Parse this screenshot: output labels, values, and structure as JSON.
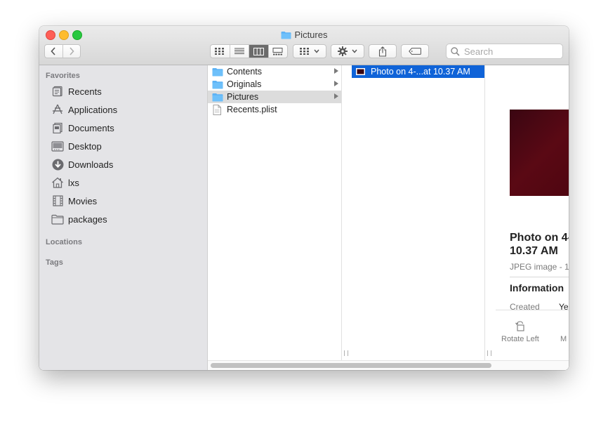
{
  "window": {
    "title": "Pictures"
  },
  "toolbar": {
    "search_placeholder": "Search"
  },
  "sidebar": {
    "favorites_label": "Favorites",
    "items": [
      {
        "label": "Recents",
        "icon": "recents-icon"
      },
      {
        "label": "Applications",
        "icon": "applications-icon"
      },
      {
        "label": "Documents",
        "icon": "documents-icon"
      },
      {
        "label": "Desktop",
        "icon": "desktop-icon"
      },
      {
        "label": "Downloads",
        "icon": "downloads-icon"
      },
      {
        "label": "lxs",
        "icon": "home-icon"
      },
      {
        "label": "Movies",
        "icon": "movies-icon"
      },
      {
        "label": "packages",
        "icon": "folder-icon"
      }
    ],
    "locations_label": "Locations",
    "tags_label": "Tags"
  },
  "column1": {
    "items": [
      {
        "label": "Contents",
        "type": "folder",
        "has_children": true
      },
      {
        "label": "Originals",
        "type": "folder",
        "has_children": true
      },
      {
        "label": "Pictures",
        "type": "folder",
        "has_children": true,
        "selected": true
      },
      {
        "label": "Recents.plist",
        "type": "file",
        "has_children": false
      }
    ]
  },
  "column2": {
    "items": [
      {
        "label": "Photo on 4-...at 10.37 AM",
        "type": "image",
        "selected": true
      }
    ]
  },
  "preview": {
    "title": "Photo on 4-\n10.37 AM",
    "subtitle": "JPEG image - 1",
    "info_heading": "Information",
    "created_label": "Created",
    "created_value": "Ye",
    "actions": [
      {
        "label": "Rotate Left",
        "icon": "rotate-left-icon"
      },
      {
        "label": "M",
        "icon": "more-icon"
      }
    ]
  },
  "colors": {
    "selection_blue": "#0f63d8",
    "folder_blue": "#5db2f5"
  }
}
